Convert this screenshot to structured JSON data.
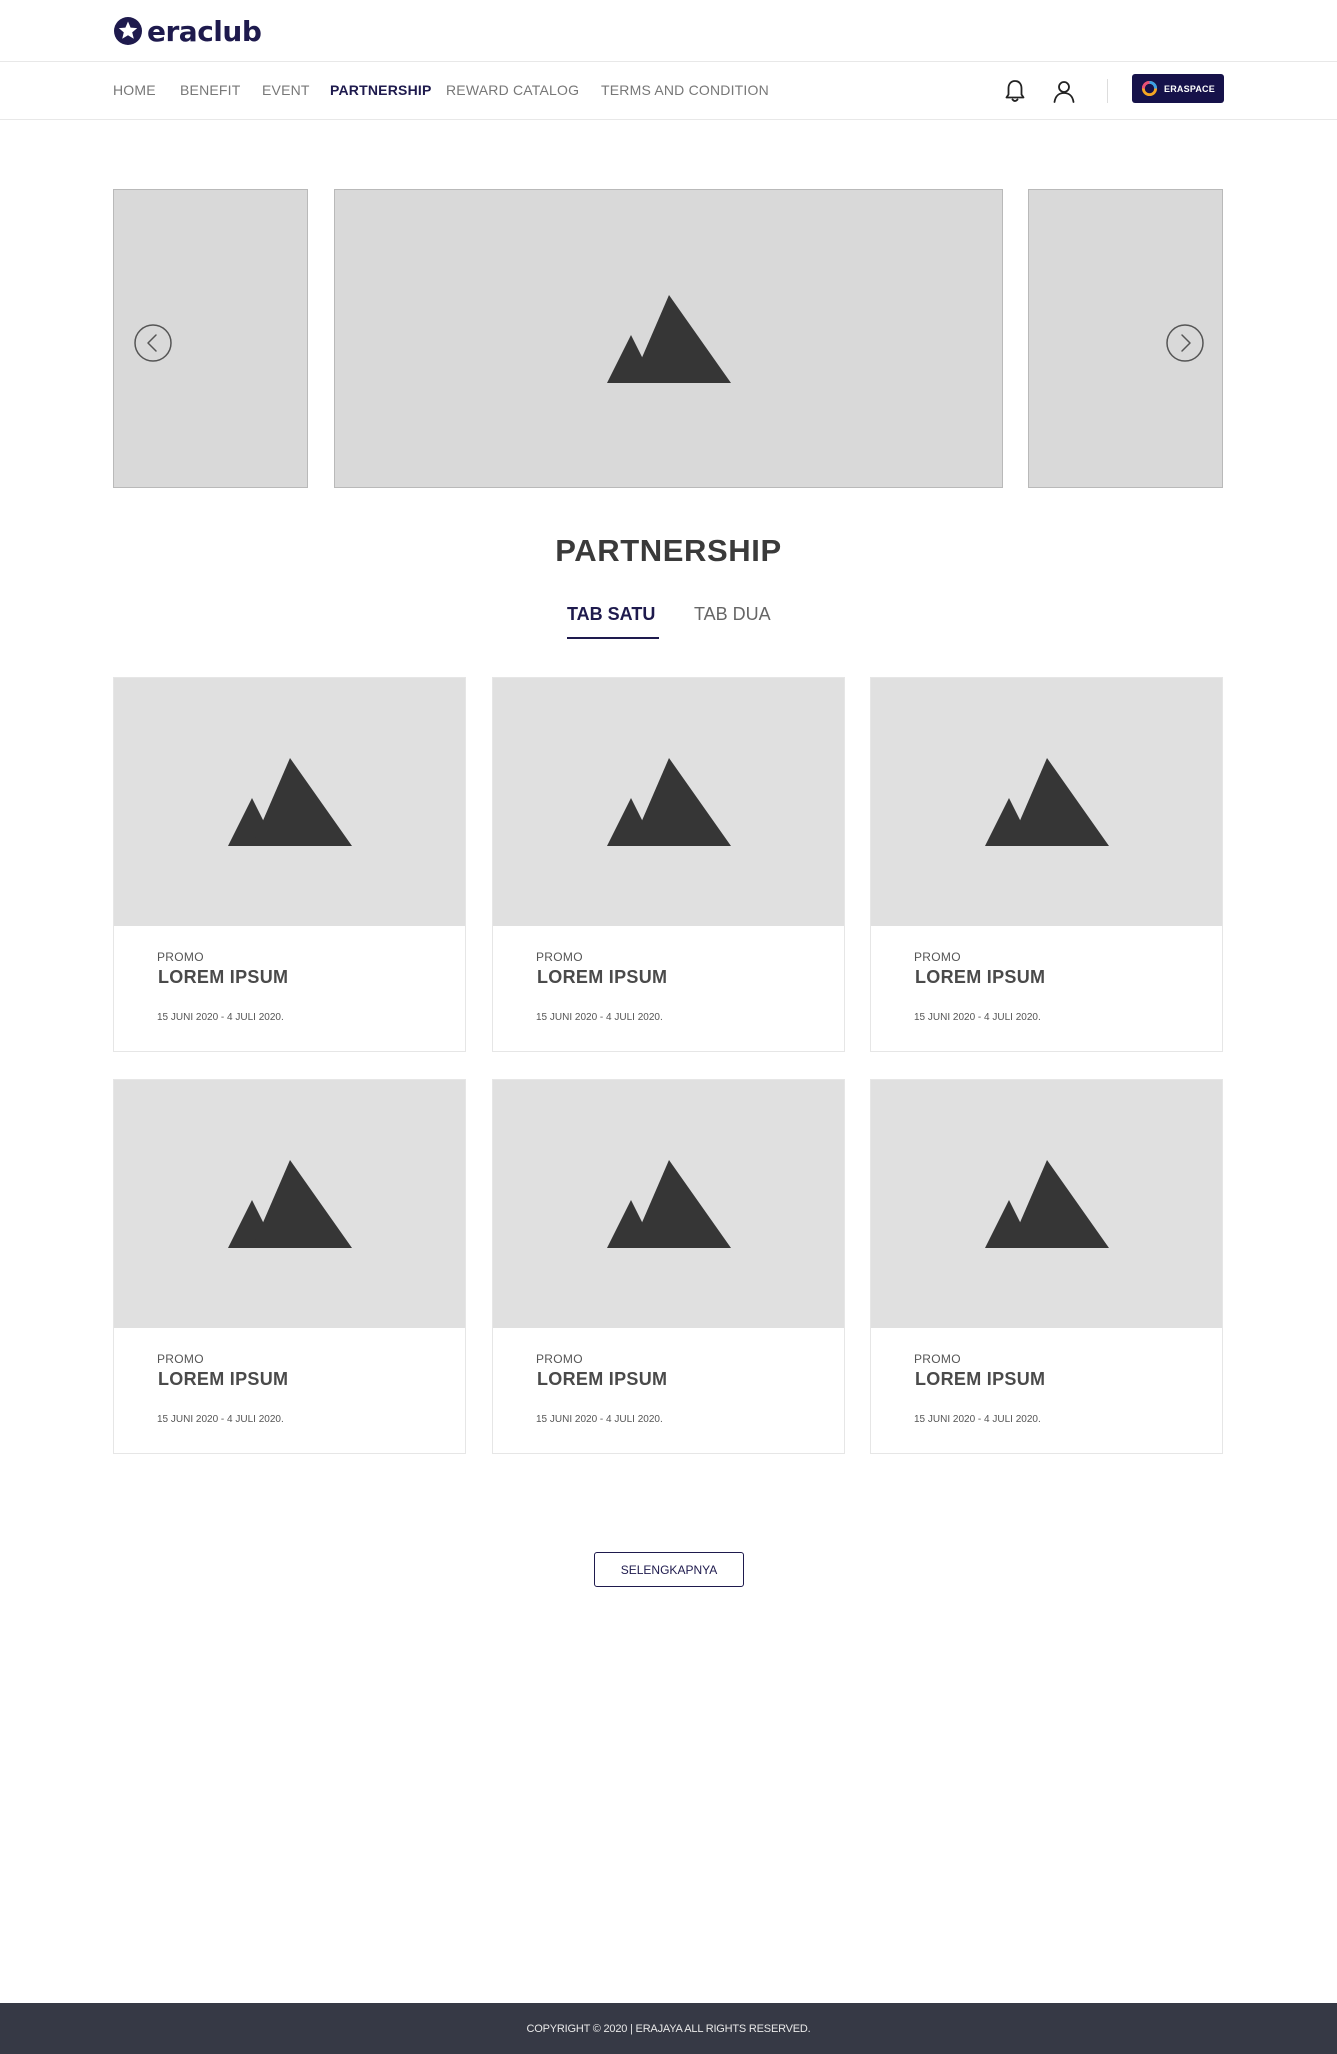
{
  "brand": {
    "logo_text": "eraclub",
    "logo_icon": "star-circle-icon",
    "accent_color": "#1e1a4d"
  },
  "nav": {
    "items": [
      {
        "label": "HOME"
      },
      {
        "label": "BENEFIT"
      },
      {
        "label": "EVENT"
      },
      {
        "label": "PARTNERSHIP",
        "active": true
      },
      {
        "label": "REWARD CATALOG"
      },
      {
        "label": "TERMS AND CONDITION"
      }
    ],
    "icons": [
      "bell-icon",
      "user-icon"
    ],
    "eraspace_label": "ERASPACE"
  },
  "carousel": {
    "slides": 3,
    "prev_icon": "chevron-left-icon",
    "next_icon": "chevron-right-icon"
  },
  "section": {
    "title": "PARTNERSHIP"
  },
  "tabs": [
    {
      "label": "TAB SATU",
      "active": true
    },
    {
      "label": "TAB DUA"
    }
  ],
  "cards": [
    {
      "category": "PROMO",
      "title": "LOREM IPSUM",
      "date": "15 JUNI 2020 - 4 JULI 2020."
    },
    {
      "category": "PROMO",
      "title": "LOREM IPSUM",
      "date": "15 JUNI 2020 - 4 JULI 2020."
    },
    {
      "category": "PROMO",
      "title": "LOREM IPSUM",
      "date": "15 JUNI 2020 - 4 JULI 2020."
    },
    {
      "category": "PROMO",
      "title": "LOREM IPSUM",
      "date": "15 JUNI 2020 - 4 JULI 2020."
    },
    {
      "category": "PROMO",
      "title": "LOREM IPSUM",
      "date": "15 JUNI 2020 - 4 JULI 2020."
    },
    {
      "category": "PROMO",
      "title": "LOREM IPSUM",
      "date": "15 JUNI 2020 - 4 JULI 2020."
    }
  ],
  "more_button": "SELENGKAPNYA",
  "footer": {
    "copyright": "COPYRIGHT © 2020 | ERAJAYA ALL RIGHTS RESERVED."
  }
}
